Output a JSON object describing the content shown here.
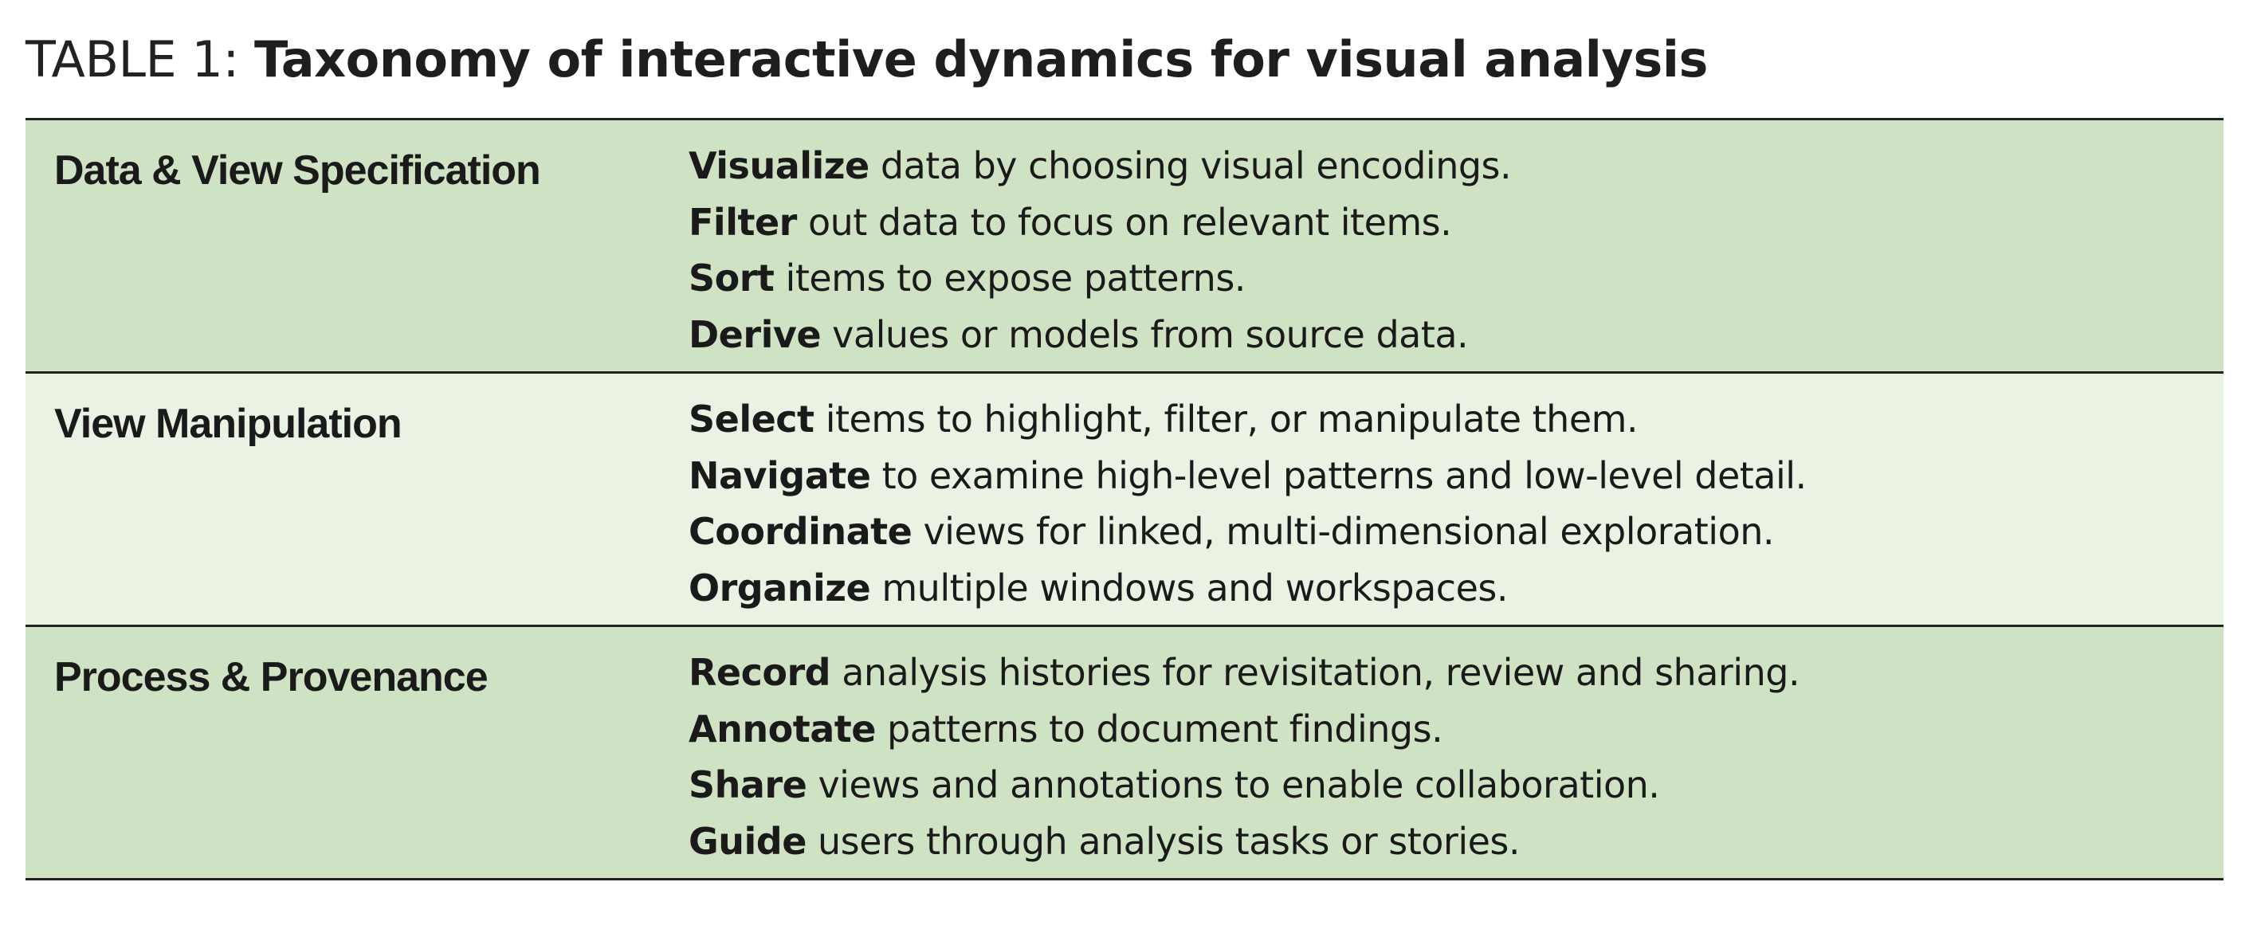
{
  "caption": {
    "label": "TABLE 1:",
    "title": "Taxonomy of interactive dynamics for visual analysis"
  },
  "rows": [
    {
      "category": "Data & View Specification",
      "actions": [
        {
          "verb": "Visualize",
          "text": "data by choosing visual encodings."
        },
        {
          "verb": "Filter",
          "text": "out data to focus on relevant items."
        },
        {
          "verb": "Sort",
          "text": "items to expose patterns."
        },
        {
          "verb": "Derive",
          "text": "values or models from source data."
        }
      ]
    },
    {
      "category": "View Manipulation",
      "actions": [
        {
          "verb": "Select",
          "text": "items to highlight, filter, or manipulate them."
        },
        {
          "verb": "Navigate",
          "text": "to examine high-level patterns and low-level detail."
        },
        {
          "verb": "Coordinate",
          "text": "views for linked, multi-dimensional exploration."
        },
        {
          "verb": "Organize",
          "text": "multiple windows and workspaces."
        }
      ]
    },
    {
      "category": "Process & Provenance",
      "actions": [
        {
          "verb": "Record",
          "text": "analysis histories for revisitation, review and sharing."
        },
        {
          "verb": "Annotate",
          "text": "patterns to document findings."
        },
        {
          "verb": "Share",
          "text": "views and annotations to enable collaboration."
        },
        {
          "verb": "Guide",
          "text": "users through analysis tasks or stories."
        }
      ]
    }
  ],
  "colors": {
    "row_dark": "#cfe2c4",
    "row_light": "#eaf2e4",
    "rule": "#222222"
  }
}
